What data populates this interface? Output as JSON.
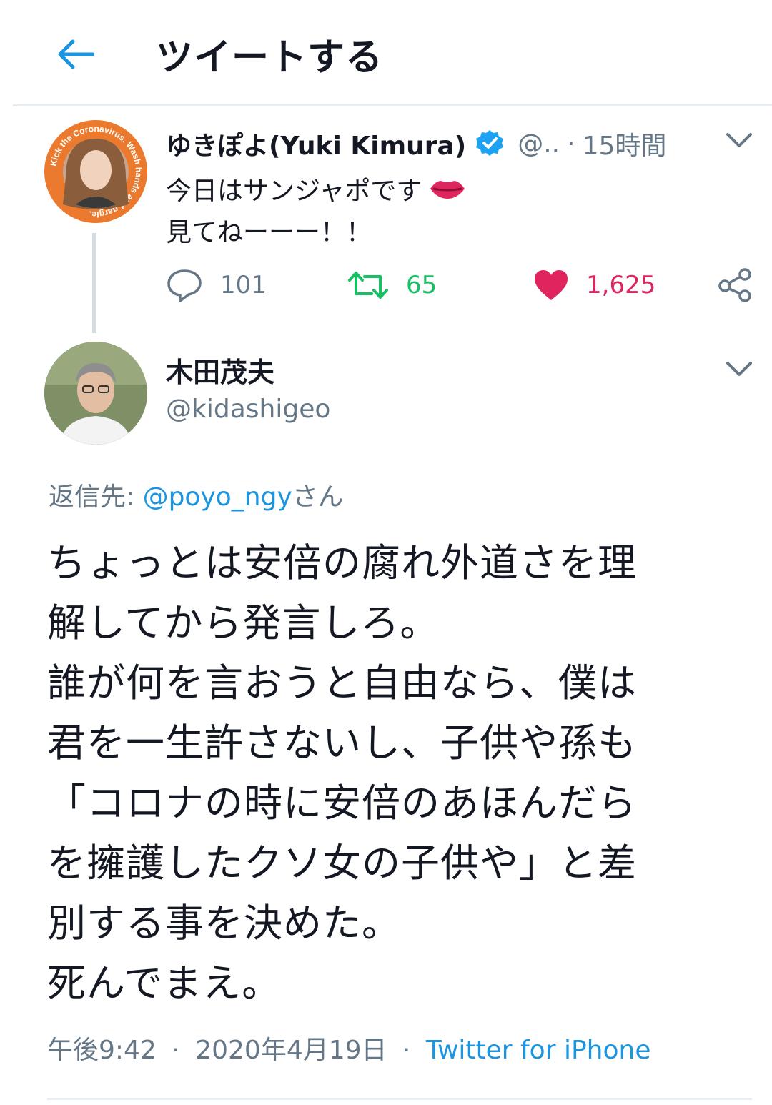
{
  "header": {
    "title": "ツイートする",
    "back_icon": "arrow-left-icon"
  },
  "original_tweet": {
    "name": "ゆきぽよ(Yuki Kimura)",
    "handle": "@..",
    "separator": "·",
    "time": "15時間",
    "text_line1": "今日はサンジャポです",
    "text_line2": "見てねーーー！！",
    "emoji": "lips-icon",
    "avatar_ring_text": "Kick the Coronavirus. Wash hands and gargle.",
    "reply_count": "101",
    "retweet_count": "65",
    "like_count": "1,625"
  },
  "reply_tweet": {
    "name": "木田茂夫",
    "handle": "@kidashigeo",
    "reply_to_label": "返信先: ",
    "reply_to_handle": "@poyo_ngy",
    "reply_to_suffix": "さん",
    "text_lines": [
      "ちょっとは安倍の腐れ外道さを理",
      "解してから発言しろ。",
      "誰が何を言おうと自由なら、僕は",
      "君を一生許さないし、子供や孫も",
      "「コロナの時に安倍のあほんだら",
      "を擁護したクソ女の子供や」と差",
      "別する事を決めた。",
      "死んでまえ。"
    ],
    "time": "午後9:42",
    "separator": "·",
    "date": "2020年4月19日",
    "source": "Twitter for iPhone"
  },
  "colors": {
    "accent": "#1b95e0",
    "verified": "#1da1f2",
    "retweet": "#17bf63",
    "like": "#e0245e",
    "secondary_text": "#657786",
    "avatar_ring": "#ec7a2e"
  }
}
